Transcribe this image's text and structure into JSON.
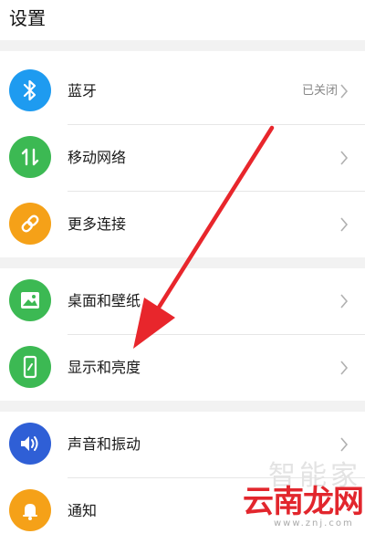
{
  "header": {
    "title": "设置"
  },
  "items": [
    {
      "label": "蓝牙",
      "status": "已关闭",
      "icon": "bluetooth-icon",
      "color": "#1e9bf0"
    },
    {
      "label": "移动网络",
      "status": "",
      "icon": "mobile-network-icon",
      "color": "#3cb953"
    },
    {
      "label": "更多连接",
      "status": "",
      "icon": "link-icon",
      "color": "#f5a118"
    },
    {
      "label": "桌面和壁纸",
      "status": "",
      "icon": "wallpaper-icon",
      "color": "#3cb953"
    },
    {
      "label": "显示和亮度",
      "status": "",
      "icon": "display-brightness-icon",
      "color": "#3cb953"
    },
    {
      "label": "声音和振动",
      "status": "",
      "icon": "speaker-icon",
      "color": "#2f5fd6"
    },
    {
      "label": "通知",
      "status": "",
      "icon": "bell-icon",
      "color": "#f5a118"
    }
  ],
  "annotation": {
    "arrow_color": "#e8262c"
  },
  "watermark": {
    "top": "智能家",
    "main": "云南龙网",
    "sub": "www.znj.com"
  }
}
